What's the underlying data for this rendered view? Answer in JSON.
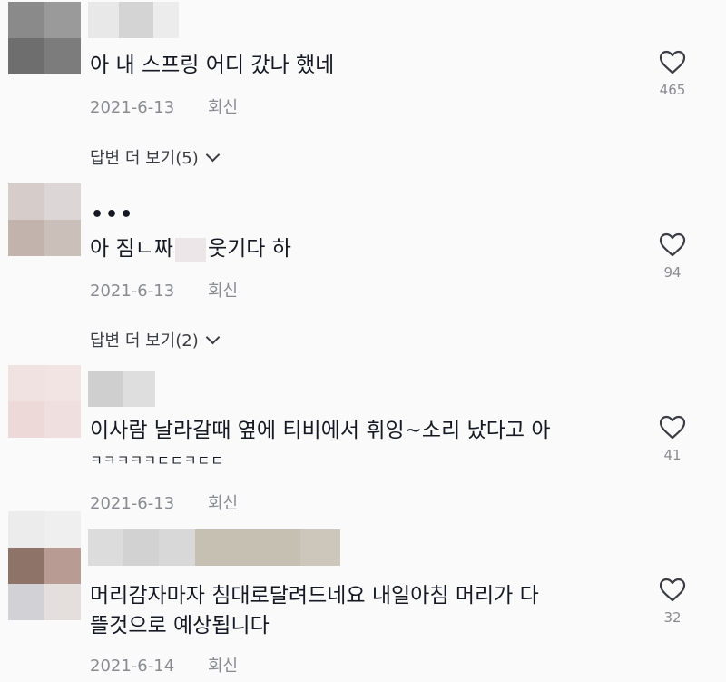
{
  "comments": [
    {
      "text": "아 내 스프링 어디 갔나 했네",
      "date": "2021-6-13",
      "reply_label": "회신",
      "likes": "465",
      "more_replies": "답변 더 보기(5)",
      "colors": {
        "avatar": [
          "#8a8a8a",
          "#9a9a9a",
          "#6e6e6e",
          "#7c7c7c"
        ],
        "name": [
          "#e8e8e8",
          "#d4d4d4",
          "#ececec"
        ]
      }
    },
    {
      "dots": "•••",
      "text_before": "아 짐ㄴ짜",
      "text_after": "웃기다 하",
      "date": "2021-6-13",
      "reply_label": "회신",
      "likes": "94",
      "more_replies": "답변 더 보기(2)",
      "colors": {
        "avatar": [
          "#d6ccc9",
          "#dcd7d6",
          "#c2b3ad",
          "#cbbfba"
        ]
      }
    },
    {
      "text_line1": "이사람 날라갈때 옆에 티비에서 휘잉~소리 났다고 아",
      "text_line2": "ㅋㅋㅋㅋㅋㅌㅌㅋㅌㅌ",
      "date": "2021-6-13",
      "reply_label": "회신",
      "likes": "41",
      "colors": {
        "avatar": [
          "#f0e2e1",
          "#f2e4e3",
          "#edd9d8",
          "#efdfde"
        ],
        "name": [
          "#cfcfcf",
          "#dedede"
        ]
      }
    },
    {
      "text_line1": "머리감자마자 침대로달려드네요 내일아침 머리가 다",
      "text_line2": "뜰것으로 예상됩니다",
      "date": "2021-6-14",
      "reply_label": "회신",
      "likes": "32",
      "colors": {
        "avatar": [
          "#8e7368",
          "#b89b92",
          "#d2d1d6",
          "#e4dfdd"
        ],
        "name": [
          "#dcdcdc",
          "#d2d2d2",
          "#d8d8d8",
          "#c6c0b2",
          "#cdc6ba"
        ]
      }
    }
  ]
}
